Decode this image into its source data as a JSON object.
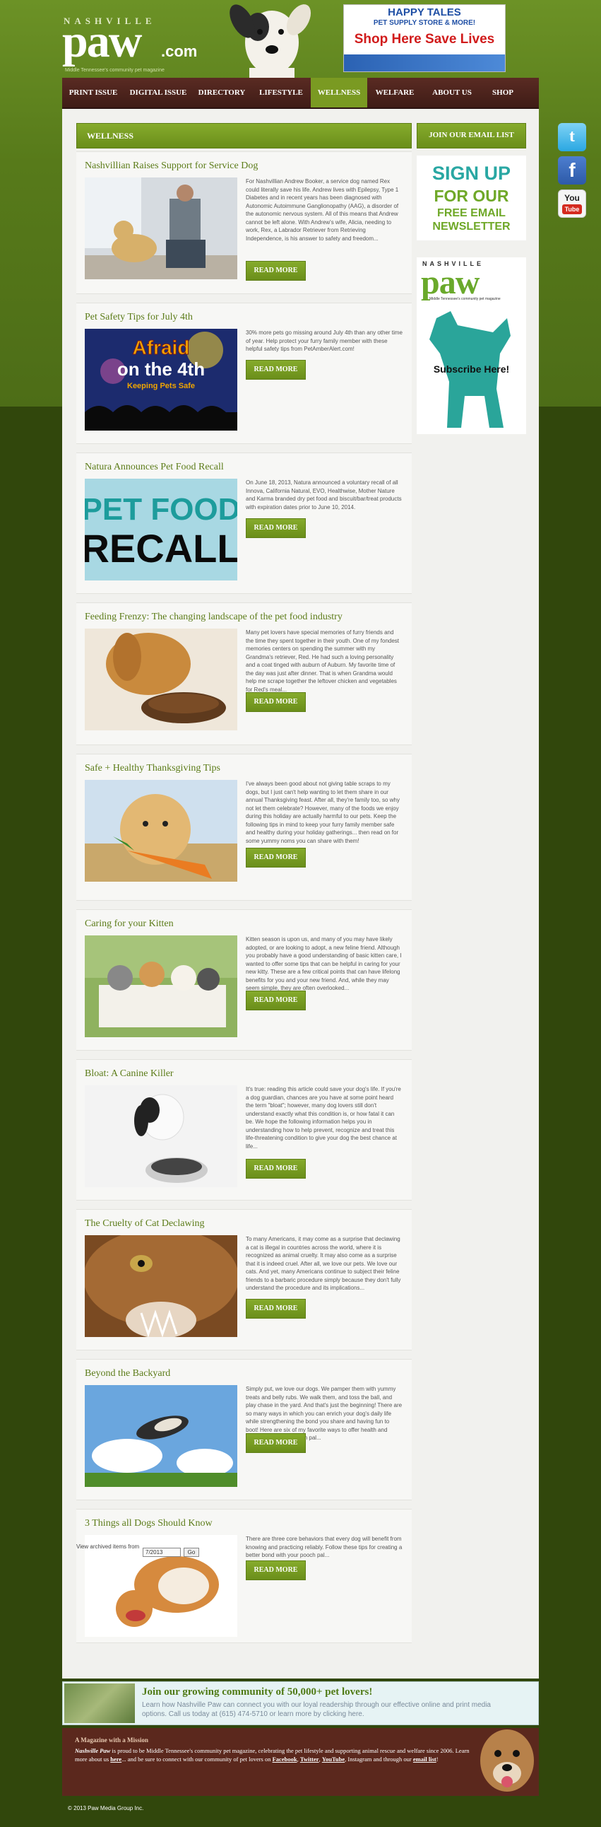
{
  "header": {
    "logo_small": "NASHVILLE",
    "logo_big": "paw",
    "logo_com": ".com",
    "logo_tagline": "Middle Tennessee's community pet magazine",
    "ad": {
      "line1": "HAPPY TALES",
      "line2": "PET SUPPLY  STORE & MORE!",
      "line3": "Shop Here  Save Lives"
    }
  },
  "nav": [
    "PRINT ISSUE",
    "DIGITAL ISSUE",
    "DIRECTORY",
    "LIFESTYLE",
    "WELLNESS",
    "WELFARE",
    "ABOUT US",
    "SHOP"
  ],
  "section_title": "WELLNESS",
  "sidebar": {
    "heading": "JOIN OUR EMAIL LIST",
    "signup_1": "SIGN UP",
    "signup_2": "FOR OUR",
    "signup_3": "FREE EMAIL NEWSLETTER",
    "sub_top": "NASHVILLE",
    "sub_paw": "paw",
    "sub_line": "Middle Tennessee's community pet magazine",
    "sub_text": "Subscribe Here!"
  },
  "read_more": "READ MORE",
  "articles": [
    {
      "title": "Nashvillian Raises Support for Service Dog",
      "text": "For Nashvillian Andrew Booker, a service dog named Rex could literally save his life. Andrew lives with Epilepsy, Type 1 Diabetes and in recent years has been diagnosed with Autonomic Autoimmune Ganglionopathy (AAG), a disorder of the autonomic nervous system. All of this means that Andrew cannot be left alone. With Andrew's wife, Alicia, needing to work, Rex, a Labrador Retriever from Retrieving Independence, is his answer to safety and freedom..."
    },
    {
      "title": "Pet Safety Tips for July 4th",
      "text": "30% more pets go missing around July 4th than any other time of year. Help protect your furry family member with these helpful safety tips from PetAmberAlert.com!",
      "img_line1": "Afraid",
      "img_line2": "on the 4th",
      "img_line3": "Keeping Pets Safe"
    },
    {
      "title": "Natura Announces Pet Food Recall",
      "text": "On June 18, 2013, Natura announced a voluntary recall of all Innova, California Natural, EVO, Healthwise, Mother Nature and Karma branded dry pet food and biscuit/bar/treat products with expiration dates prior to June 10, 2014.",
      "img_line1": "PET FOOD",
      "img_line2": "RECALL"
    },
    {
      "title": "Feeding Frenzy: The changing landscape of the pet food industry",
      "text": "Many pet lovers have special memories of furry friends and the time they spent together in their youth. One of my fondest memories centers on spending the summer with my Grandma's retriever, Red. He had such a loving personality and a coat tinged with auburn of Auburn. My favorite time of the day was just after dinner. That is when Grandma would help me scrape together the leftover chicken and vegetables for Red's meal..."
    },
    {
      "title": "Safe + Healthy Thanksgiving Tips",
      "text": "I've always been good about not giving table scraps to my dogs, but I just can't help wanting to let them share in our annual Thanksgiving feast. After all, they're family too, so why not let them celebrate? However, many of the foods we enjoy during this holiday are actually harmful to our pets. Keep the following tips in mind to keep your furry family member safe and healthy during your holiday gatherings... then read on for some yummy noms you can share with them!"
    },
    {
      "title": "Caring for your Kitten",
      "text": "Kitten season is upon us, and many of you may have likely adopted, or are looking to adopt, a new feline friend. Although you probably have a good understanding of basic kitten care, I wanted to offer some tips that can be helpful in caring for your new kitty. These are a few critical points that can have lifelong benefits for you and your new friend. And, while they may seem simple, they are often overlooked..."
    },
    {
      "title": "Bloat: A Canine Killer",
      "text": "It's true: reading this article could save your dog's life. If you're a dog guardian, chances are you have at some point heard the term \"bloat\"; however, many dog lovers still don't understand exactly what this condition is, or how fatal it can be. We hope the following information helps you in understanding how to help prevent, recognize and treat this life-threatening condition to give your dog the best chance at life..."
    },
    {
      "title": "The Cruelty of Cat Declawing",
      "text": "To many Americans, it may come as a surprise that declawing a cat is illegal in countries across the world, where it is recognized as animal cruelty. It may also come as a surprise that it is indeed cruel. After all, we love our pets. We love our cats. And yet, many Americans continue to subject their feline friends to a barbaric procedure simply because they don't fully understand the procedure and its implications..."
    },
    {
      "title": "Beyond the Backyard",
      "text": "Simply put, we love our dogs. We pamper them with yummy treats and belly rubs. We walk them, and toss the ball, and play chase in the yard. And that's just the beginning! There are so many ways in which you can enrich your dog's daily life while strengthening the bond you share and having fun to boot! Here are six of my favorite ways to offer health and happiness to your pooch pal..."
    },
    {
      "title": "3 Things all Dogs Should Know",
      "text": "There are three core behaviors that every dog will benefit from knowing and practicing reliably. Follow these tips for creating a better bond with your pooch pal..."
    }
  ],
  "archive": {
    "label": "View archived items from",
    "value": "7/2013",
    "go": "Go"
  },
  "social": {
    "twitter": "t",
    "facebook": "f",
    "youtube_1": "You",
    "youtube_2": "Tube"
  },
  "promo": {
    "heading": "Join our growing community of 50,000+ pet lovers!",
    "text": "Learn how Nashville Paw can connect you with our loyal readership through our effective online and print media options. Call us today at (615) 474-5710 or learn more by clicking here."
  },
  "mission": {
    "heading": "A Magazine with a Mission",
    "text_1": "Nashville Paw",
    "text_2": " is proud to be Middle Tennessee's community pet magazine, celebrating the pet lifestyle and supporting animal rescue and welfare since 2006. Learn more about us ",
    "link_here": "here",
    "text_3": "... and be sure to connect with our community of pet lovers on ",
    "link_fb": "Facebook",
    "link_tw": "Twitter",
    "link_yt": "YouTube",
    "text_4": ", Instagram and through our ",
    "link_email": "email list",
    "text_5": "!"
  },
  "copyright": "© 2013 Paw Media Group Inc.",
  "colors": {
    "brand_green": "#7a9a22",
    "nav_brown": "#4f241c",
    "title_green": "#5c7c19"
  }
}
